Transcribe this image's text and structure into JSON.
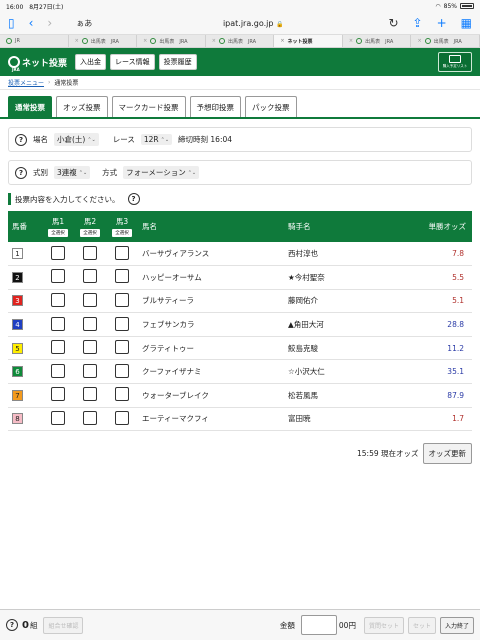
{
  "status": {
    "time": "16:00",
    "date": "8月27日(土)",
    "battery": "85%"
  },
  "browser": {
    "aa": "ぁあ",
    "url": "ipat.jra.go.jp"
  },
  "tabs": [
    {
      "label": "JR"
    },
    {
      "label": "出馬表　JRA"
    },
    {
      "label": "出馬表　JRA"
    },
    {
      "label": "出馬表　JRA"
    },
    {
      "label": "ネット投票",
      "active": true
    },
    {
      "label": "出馬表　JRA"
    },
    {
      "label": "出馬表　JRA"
    }
  ],
  "header": {
    "logo_text": "ネット投票",
    "logo_sub": "JRA",
    "buttons": [
      "入出金",
      "レース情報",
      "投票履歴"
    ],
    "purchase_list": "購入予定リスト"
  },
  "breadcrumb": {
    "menu": "投票メニュー",
    "current": "通常投票"
  },
  "main_tabs": [
    "通常投票",
    "オッズ投票",
    "マークカード投票",
    "予想印投票",
    "パック投票"
  ],
  "race": {
    "venue_label": "場名",
    "venue_value": "小倉(土)",
    "race_label": "レース",
    "race_value": "12R",
    "deadline": "締切時刻 16:04"
  },
  "bet": {
    "type_label": "式別",
    "type_value": "3連複",
    "method_label": "方式",
    "method_value": "フォーメーション"
  },
  "instruction": "投票内容を入力してください。",
  "table": {
    "headers": {
      "number": "馬番",
      "h1": "馬1",
      "h2": "馬2",
      "h3": "馬3",
      "name": "馬名",
      "jockey": "騎手名",
      "odds": "単勝オッズ"
    },
    "select_all": "全選択",
    "rows": [
      {
        "no": "1",
        "name": "バーサヴィアランス",
        "jockey": "西村淳也",
        "odds": "7.8",
        "bg": "#ffffff",
        "fg": "#222222",
        "odds_color": "red"
      },
      {
        "no": "2",
        "name": "ハッピーオーサム",
        "jockey": "★今村聖奈",
        "odds": "5.5",
        "bg": "#111111",
        "fg": "#ffffff",
        "odds_color": "red"
      },
      {
        "no": "3",
        "name": "ブルサティーラ",
        "jockey": "藤岡佑介",
        "odds": "5.1",
        "bg": "#e0231f",
        "fg": "#ffffff",
        "odds_color": "red"
      },
      {
        "no": "4",
        "name": "フェブサンカラ",
        "jockey": "▲角田大河",
        "odds": "28.8",
        "bg": "#1f3fc2",
        "fg": "#ffffff",
        "odds_color": "blue"
      },
      {
        "no": "5",
        "name": "グラティトゥー",
        "jockey": "鮫島克駿",
        "odds": "11.2",
        "bg": "#ffee00",
        "fg": "#222222",
        "odds_color": "blue"
      },
      {
        "no": "6",
        "name": "クーファイザナミ",
        "jockey": "☆小沢大仁",
        "odds": "35.1",
        "bg": "#0f8a3a",
        "fg": "#ffffff",
        "odds_color": "blue"
      },
      {
        "no": "7",
        "name": "ウォーターブレイク",
        "jockey": "松若風馬",
        "odds": "87.9",
        "bg": "#f39a1e",
        "fg": "#222222",
        "odds_color": "blue"
      },
      {
        "no": "8",
        "name": "エーティーマクフィ",
        "jockey": "富田暁",
        "odds": "1.7",
        "bg": "#f6bcc6",
        "fg": "#222222",
        "odds_color": "red"
      }
    ]
  },
  "odds_status": {
    "time": "15:59 現在オッズ",
    "update_button": "オッズ更新"
  },
  "footer": {
    "count": "0",
    "count_unit": "組",
    "confirm_button": "組合せ確認",
    "amount_label": "金額",
    "amount_unit": "00円",
    "clear_set_button": "質問セット",
    "set_button": "セット",
    "finish_button": "入力終了"
  }
}
